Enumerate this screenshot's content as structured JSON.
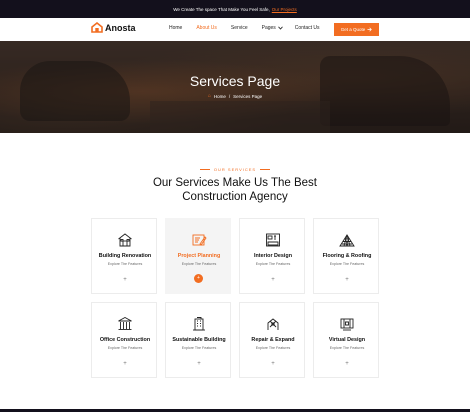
{
  "topbar": {
    "message": "We Create The space That Make You Feel Safe,",
    "link": "Our Projects"
  },
  "brand": {
    "name": "Anosta",
    "accent": "#f26d21",
    "dark": "#13101c"
  },
  "nav": {
    "items": [
      {
        "label": "Home"
      },
      {
        "label": "About Us",
        "active": true
      },
      {
        "label": "Service"
      },
      {
        "label": "Pages",
        "dropdown": true
      },
      {
        "label": "Contact Us"
      }
    ],
    "cta": "Get a Quote"
  },
  "hero": {
    "title": "Services Page",
    "breadcrumb": [
      "Home",
      "Services Page"
    ]
  },
  "section": {
    "eyebrow": "OUR SERVICES",
    "title": "Our Services Make Us The Best Construction Agency"
  },
  "services": [
    {
      "title": "Building Renovation",
      "subtitle": "Explore The Features",
      "icon": "house-icon",
      "button": "+"
    },
    {
      "title": "Project Planning",
      "subtitle": "Explore The Features",
      "icon": "blueprint-icon",
      "button": "+",
      "featured": true
    },
    {
      "title": "Interior Design",
      "subtitle": "Explore The Features",
      "icon": "interior-icon",
      "button": "+"
    },
    {
      "title": "Flooring & Roofing",
      "subtitle": "Explore The Features",
      "icon": "roof-icon",
      "button": "+"
    },
    {
      "title": "Office Construction",
      "subtitle": "Explore The Features",
      "icon": "office-icon",
      "button": "+"
    },
    {
      "title": "Sustainable Building",
      "subtitle": "Explore The Features",
      "icon": "building-icon",
      "button": "+"
    },
    {
      "title": "Repair & Expand",
      "subtitle": "Explore The Features",
      "icon": "repair-icon",
      "button": "+"
    },
    {
      "title": "Virtual Design",
      "subtitle": "Explore The Features",
      "icon": "virtual-design-icon",
      "button": "+"
    }
  ]
}
